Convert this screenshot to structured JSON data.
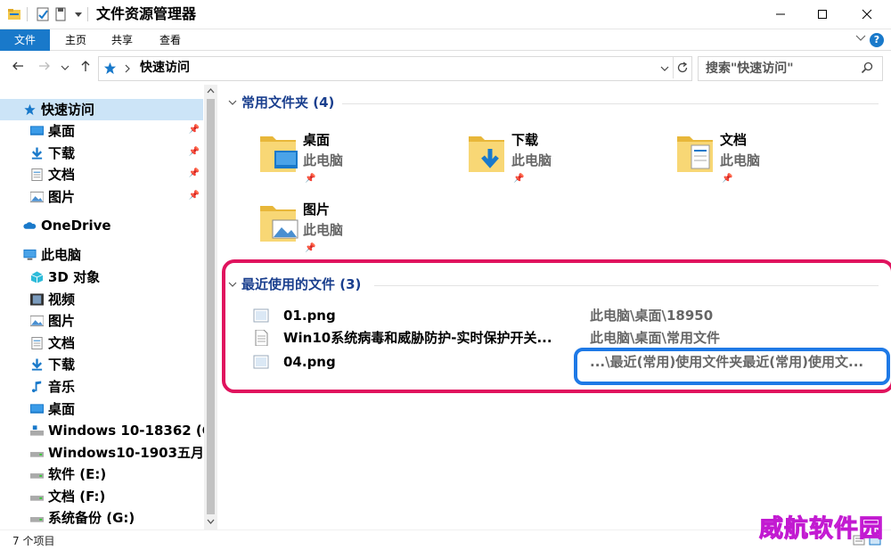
{
  "window": {
    "title": "文件资源管理器"
  },
  "ribbon": {
    "tabs": [
      "文件",
      "主页",
      "共享",
      "查看"
    ],
    "help": "?"
  },
  "address": {
    "path": "快速访问",
    "search_placeholder": "搜索\"快速访问\""
  },
  "nav": {
    "quick_access": "快速访问",
    "quick_items": [
      {
        "label": "桌面",
        "icon": "desktop-icon",
        "pinned": true
      },
      {
        "label": "下载",
        "icon": "download-icon",
        "pinned": true
      },
      {
        "label": "文档",
        "icon": "document-icon",
        "pinned": true
      },
      {
        "label": "图片",
        "icon": "picture-icon",
        "pinned": true
      }
    ],
    "onedrive": "OneDrive",
    "this_pc": "此电脑",
    "pc_items": [
      {
        "label": "3D 对象",
        "icon": "3d-objects-icon"
      },
      {
        "label": "视频",
        "icon": "video-icon"
      },
      {
        "label": "图片",
        "icon": "picture-icon"
      },
      {
        "label": "文档",
        "icon": "document-icon"
      },
      {
        "label": "下载",
        "icon": "download-icon"
      },
      {
        "label": "音乐",
        "icon": "music-icon"
      },
      {
        "label": "桌面",
        "icon": "desktop-icon"
      },
      {
        "label": "Windows 10-18362 (C",
        "icon": "system-drive-icon"
      },
      {
        "label": "Windows10-1903五月",
        "icon": "drive-icon"
      },
      {
        "label": "软件 (E:)",
        "icon": "drive-icon"
      },
      {
        "label": "文档 (F:)",
        "icon": "drive-icon"
      },
      {
        "label": "系统备份 (G:)",
        "icon": "drive-icon"
      }
    ]
  },
  "frequent": {
    "header": "常用文件夹 (4)",
    "folders": [
      {
        "name": "桌面",
        "location": "此电脑",
        "icon": "desktop-folder-icon"
      },
      {
        "name": "下载",
        "location": "此电脑",
        "icon": "download-folder-icon"
      },
      {
        "name": "文档",
        "location": "此电脑",
        "icon": "document-folder-icon"
      },
      {
        "name": "图片",
        "location": "此电脑",
        "icon": "picture-folder-icon"
      }
    ]
  },
  "recent": {
    "header": "最近使用的文件 (3)",
    "files": [
      {
        "name": "01.png",
        "path": "此电脑\\桌面\\18950",
        "icon": "image-file-icon"
      },
      {
        "name": "Win10系统病毒和威胁防护-实时保护开关...",
        "path": "此电脑\\桌面\\常用文件",
        "icon": "text-file-icon"
      },
      {
        "name": "04.png",
        "path": "...\\最近(常用)使用文件夹最近(常用)使用文...",
        "icon": "image-file-icon"
      }
    ]
  },
  "status": {
    "count": "7 个项目"
  },
  "watermark": "威航软件园",
  "colors": {
    "accent": "#1979ca",
    "group_header": "#1a3f8e",
    "highlight_red": "#e0135e",
    "highlight_blue": "#1e79e6",
    "watermark": "#ff40ff"
  }
}
